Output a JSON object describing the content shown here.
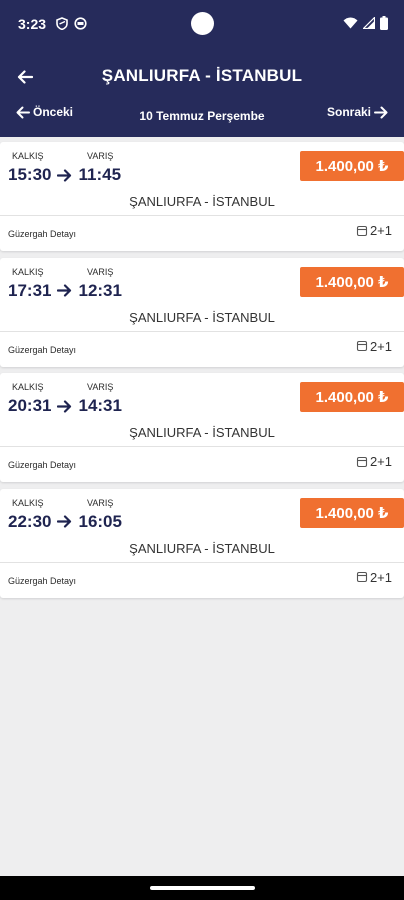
{
  "status_bar": {
    "time": "3:23"
  },
  "header": {
    "title": "ŞANLIURFA - İSTANBUL",
    "prev_label": "Önceki",
    "date": "10 Temmuz Perşembe",
    "next_label": "Sonraki"
  },
  "labels": {
    "departure": "KALKIŞ",
    "arrival": "VARIŞ",
    "route_detail": "Güzergah Detayı"
  },
  "trips": [
    {
      "departure": "15:30",
      "arrival": "11:45",
      "price": "1.400,00 ₺",
      "route": "ŞANLIURFA - İSTANBUL",
      "seat_layout": "2+1"
    },
    {
      "departure": "17:31",
      "arrival": "12:31",
      "price": "1.400,00 ₺",
      "route": "ŞANLIURFA - İSTANBUL",
      "seat_layout": "2+1"
    },
    {
      "departure": "20:31",
      "arrival": "14:31",
      "price": "1.400,00 ₺",
      "route": "ŞANLIURFA - İSTANBUL",
      "seat_layout": "2+1"
    },
    {
      "departure": "22:30",
      "arrival": "16:05",
      "price": "1.400,00 ₺",
      "route": "ŞANLIURFA - İSTANBUL",
      "seat_layout": "2+1"
    }
  ],
  "colors": {
    "header_bg": "#262b5b",
    "price_bg": "#f07030",
    "time_text": "#1f2450",
    "page_bg": "#eeeeef"
  }
}
